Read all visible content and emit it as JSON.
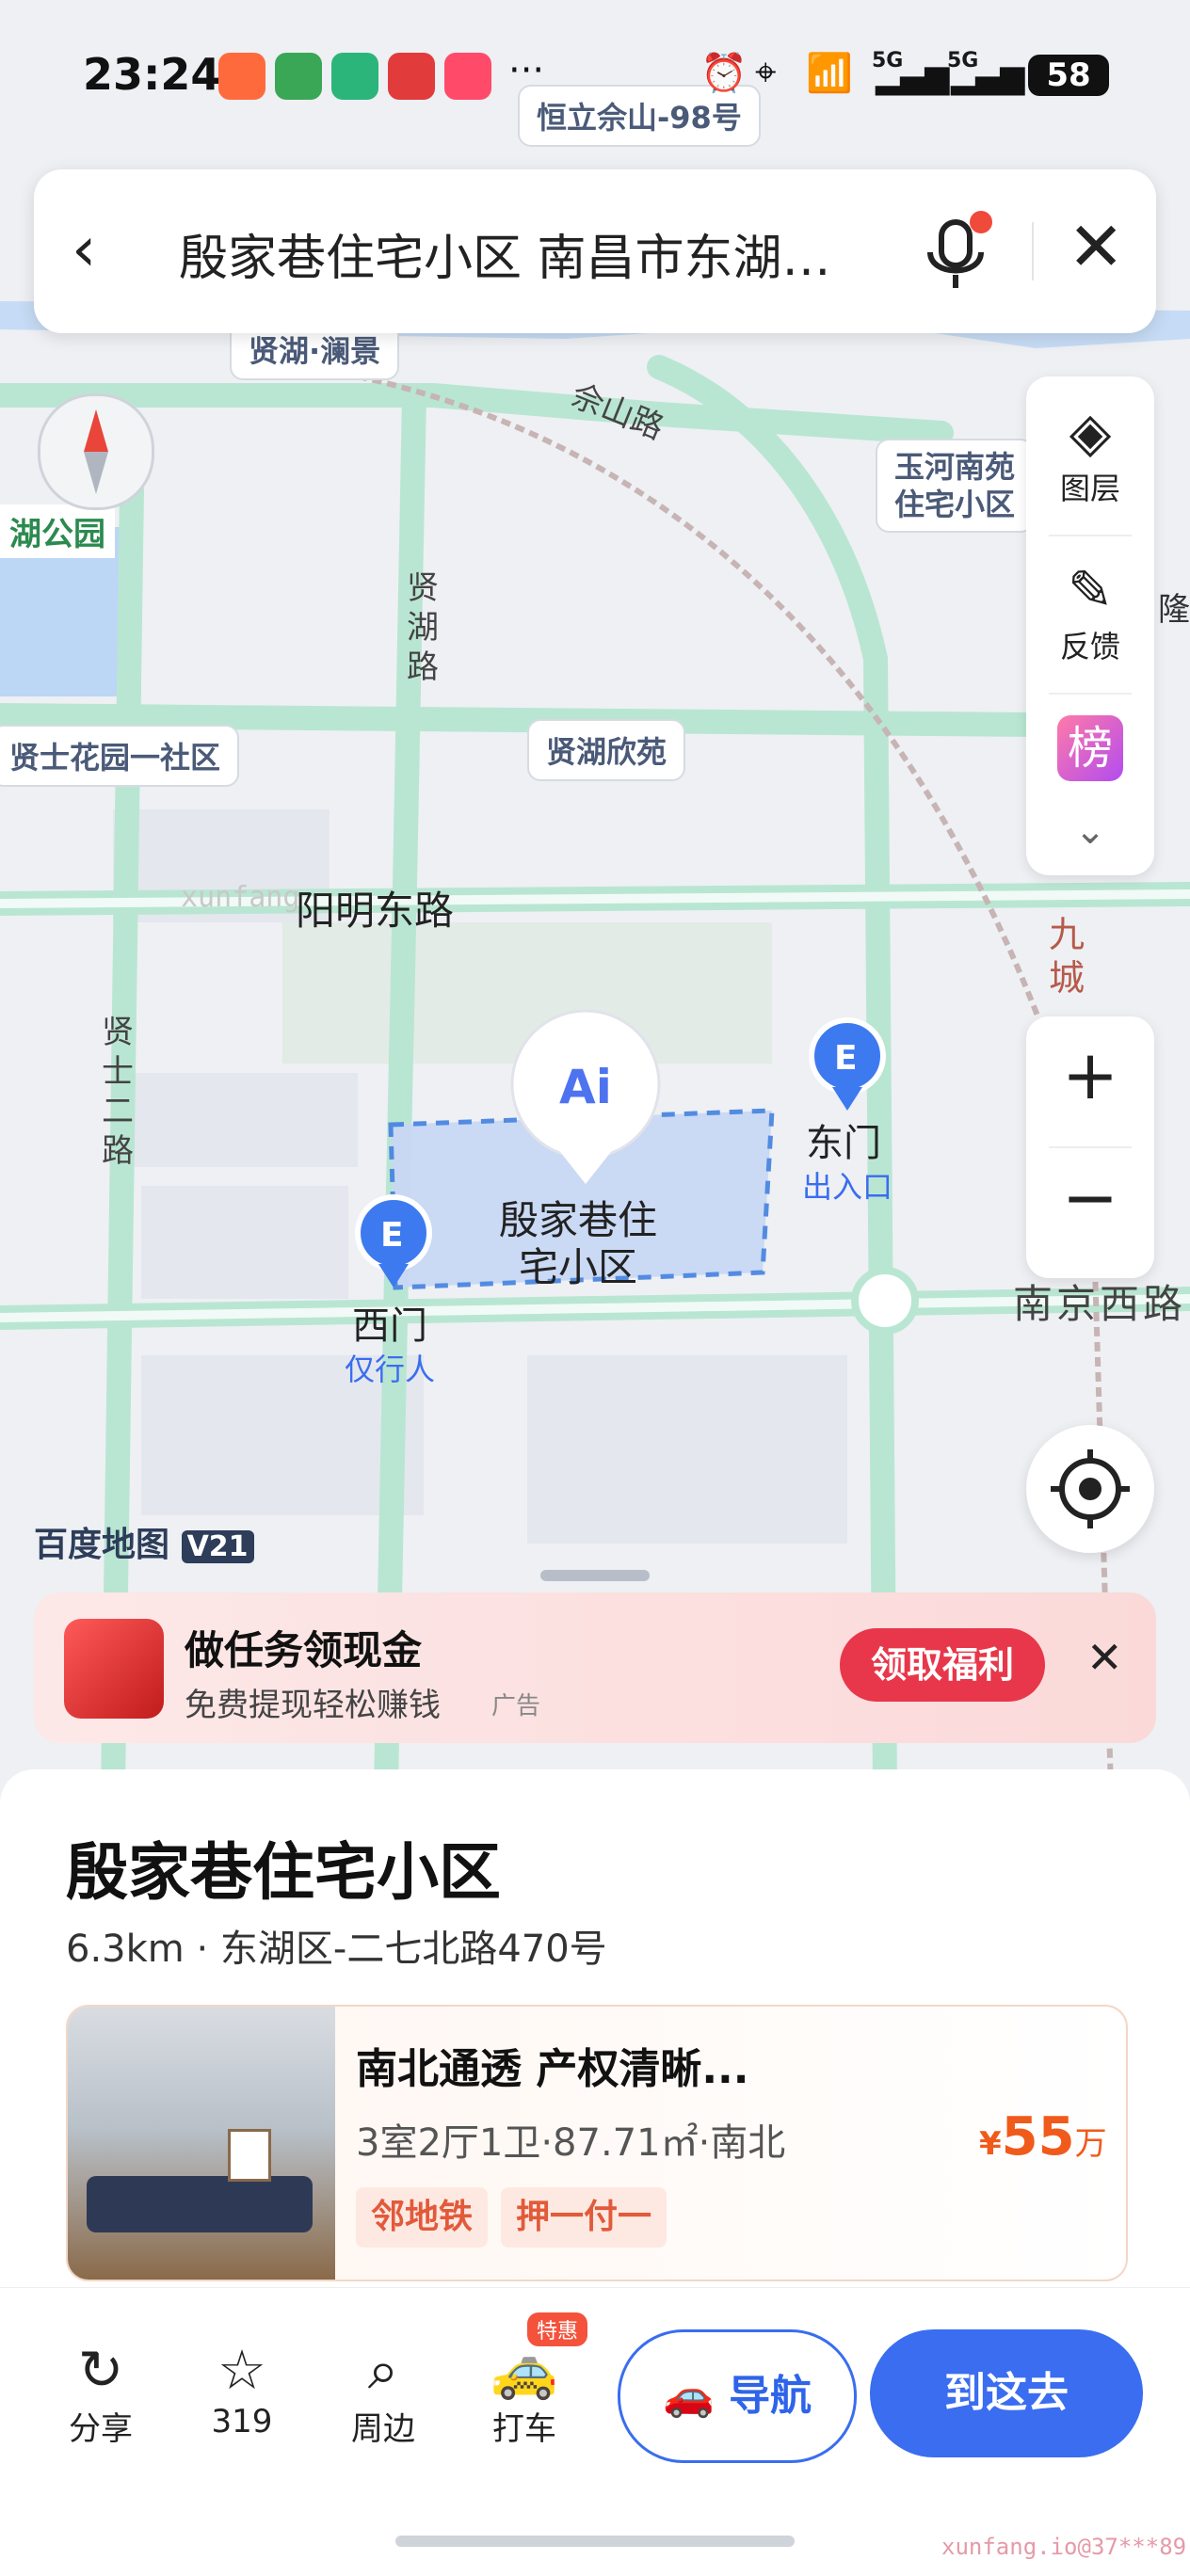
{
  "status": {
    "time": "23:24",
    "dots": "···",
    "network": "5G",
    "battery": "58"
  },
  "search": {
    "query": "殷家巷住宅小区 南昌市东湖…"
  },
  "map": {
    "labels": {
      "top": "恒立佘山-98号",
      "xianhu_lanjing": "贤湖·澜景",
      "yuhe": "玉河南苑\n住宅小区",
      "xianshi": "贤士花园一社区",
      "xianhu_xinyuan": "贤湖欣苑",
      "park": "湖公园",
      "long": "隆"
    },
    "roads": {
      "sheshan": "佘山路",
      "xianhu": "贤\n湖\n路",
      "yangming": "阳明东路",
      "xianshi_er": "贤\n士\n二\n路",
      "nanjing": "南京西路",
      "jiucheng": "九\n城"
    },
    "area_name": "殷家巷住\n宅小区",
    "gates": {
      "east": "东门",
      "east_sub": "出入口",
      "west": "西门",
      "west_sub": "仅行人"
    },
    "logo": "百度地图",
    "version": "V21",
    "watermark_map": "xunfang"
  },
  "tools": {
    "layers": "图层",
    "feedback": "反馈",
    "rank": "榜"
  },
  "ad": {
    "title": "做任务领现金",
    "subtitle": "免费提现轻松赚钱",
    "tag": "广告",
    "button": "领取福利"
  },
  "place": {
    "name": "殷家巷住宅小区",
    "info": "6.3km · 东湖区-二七北路470号"
  },
  "listing": {
    "title": "南北通透 产权清晰...",
    "detail": "3室2厅1卫·87.71㎡·南北",
    "tags": [
      "邻地铁",
      "押一付一"
    ],
    "price_symbol": "¥",
    "price": "55",
    "price_unit": "万"
  },
  "actions": {
    "share": "分享",
    "favorites": "319",
    "nearby": "周边",
    "taxi": "打车",
    "taxi_badge": "特惠",
    "navigate": "导航",
    "go": "到这去"
  },
  "watermark": "xunfang.io@37***89",
  "colors": {
    "accent": "#3a6df0",
    "ad_button": "#e8374a",
    "price": "#f05a1a",
    "road": "#a8e0c8",
    "area_fill": "#c9d8f5",
    "area_border": "#4a86e0"
  }
}
